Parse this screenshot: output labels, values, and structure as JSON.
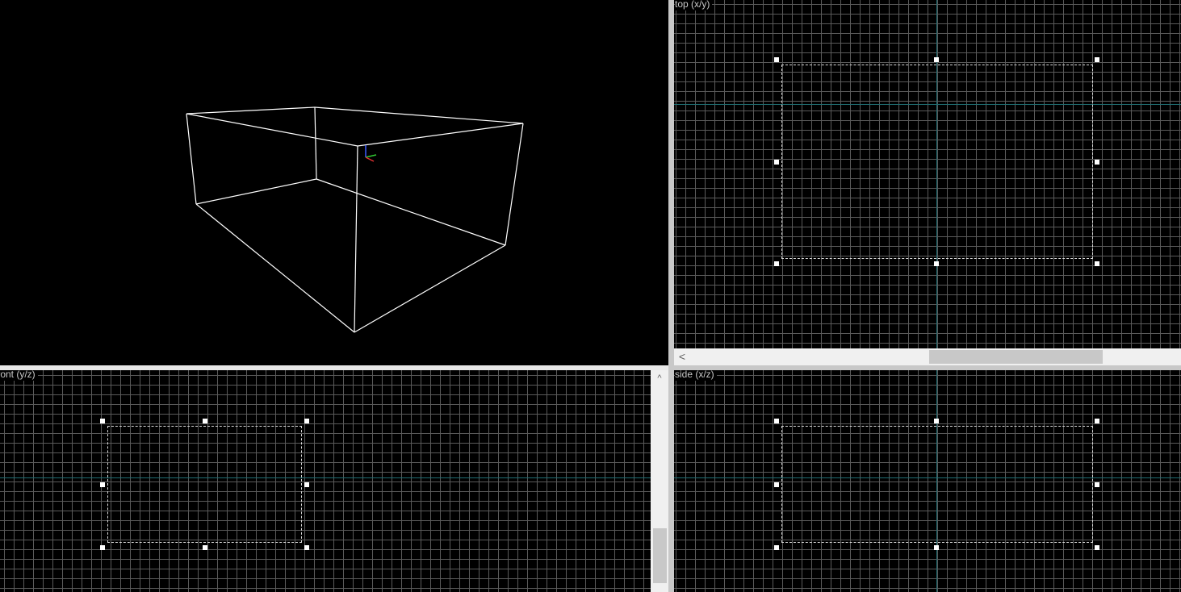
{
  "viewports": {
    "perspective": {
      "label": ""
    },
    "top": {
      "label": "top (x/y)"
    },
    "front": {
      "label": "front (y/z)"
    },
    "side": {
      "label": "side (x/z)"
    }
  },
  "scrollbars": {
    "top_horizontal": {
      "left_arrow": "<"
    },
    "front_vertical": {
      "up_arrow": "^"
    }
  },
  "colors": {
    "background": "#000000",
    "grid": "#5a5a5a",
    "axis": "#1f6e73",
    "wireframe": "#ffffff",
    "selection": "#d8d8d8"
  }
}
